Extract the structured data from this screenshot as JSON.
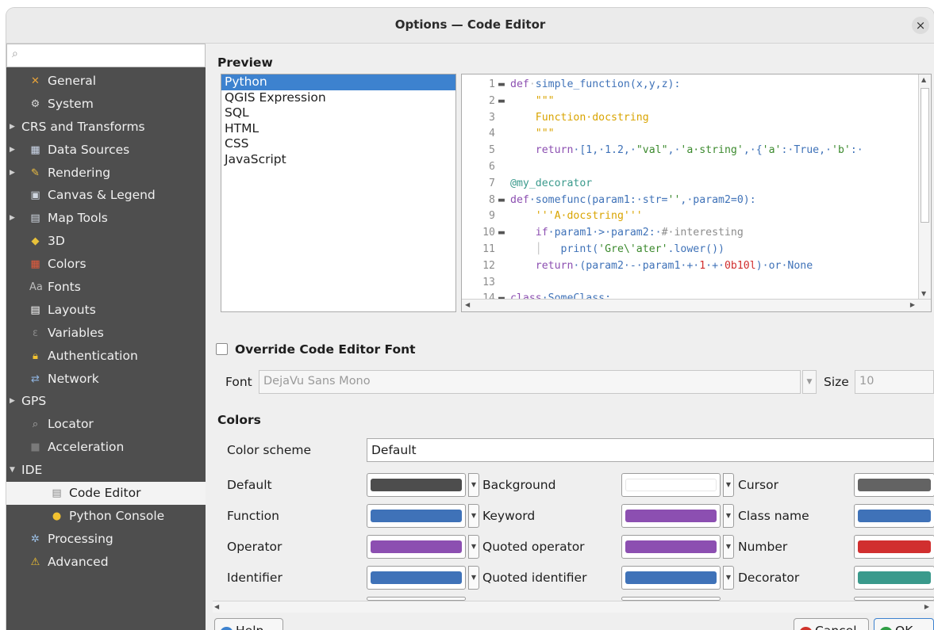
{
  "window": {
    "title": "Options — Code Editor",
    "close": "×"
  },
  "sidebar": {
    "search_placeholder": "",
    "items": [
      {
        "label": "General",
        "icon": "wrench-icon",
        "glyph": "✕",
        "color": "#e8a33a",
        "kind": "top"
      },
      {
        "label": "System",
        "icon": "system-icon",
        "glyph": "⚙",
        "color": "#d8d8d8",
        "kind": "top"
      },
      {
        "label": "CRS and Transforms",
        "icon": "",
        "glyph": "",
        "color": "",
        "kind": "cat"
      },
      {
        "label": "Data Sources",
        "icon": "table-icon",
        "glyph": "▦",
        "color": "#cdd8ea",
        "kind": "top",
        "arrow": true
      },
      {
        "label": "Rendering",
        "icon": "brush-icon",
        "glyph": "✎",
        "color": "#f0c040",
        "kind": "top",
        "arrow": true
      },
      {
        "label": "Canvas & Legend",
        "icon": "canvas-icon",
        "glyph": "▣",
        "color": "#cfd6e0",
        "kind": "top"
      },
      {
        "label": "Map Tools",
        "icon": "map-tools-icon",
        "glyph": "▤",
        "color": "#cfd6e0",
        "kind": "top",
        "arrow": true
      },
      {
        "label": "3D",
        "icon": "cube-icon",
        "glyph": "◆",
        "color": "#e8c23a",
        "kind": "top"
      },
      {
        "label": "Colors",
        "icon": "palette-icon",
        "glyph": "▦",
        "color": "#e45b3c",
        "kind": "top"
      },
      {
        "label": "Fonts",
        "icon": "fonts-icon",
        "glyph": "Aa",
        "color": "#bdbdbd",
        "kind": "top"
      },
      {
        "label": "Layouts",
        "icon": "layout-icon",
        "glyph": "▤",
        "color": "#ffffff",
        "kind": "top"
      },
      {
        "label": "Variables",
        "icon": "variables-icon",
        "glyph": "ε",
        "color": "#8a8a8a",
        "kind": "top"
      },
      {
        "label": "Authentication",
        "icon": "lock-icon",
        "glyph": "🔒︎",
        "color": "#f2c230",
        "kind": "top"
      },
      {
        "label": "Network",
        "icon": "network-icon",
        "glyph": "⇄",
        "color": "#8fb4e0",
        "kind": "top"
      },
      {
        "label": "GPS",
        "icon": "",
        "glyph": "",
        "color": "",
        "kind": "cat"
      },
      {
        "label": "Locator",
        "icon": "locator-search-icon",
        "glyph": "⌕",
        "color": "#b0b0b0",
        "kind": "top"
      },
      {
        "label": "Acceleration",
        "icon": "chip-icon",
        "glyph": "■",
        "color": "#7a7a7a",
        "kind": "top"
      },
      {
        "label": "IDE",
        "icon": "",
        "glyph": "",
        "color": "",
        "kind": "cat",
        "expanded": true
      },
      {
        "label": "Code Editor",
        "icon": "code-file-icon",
        "glyph": "▤",
        "color": "#8a8a8a",
        "kind": "sub",
        "selected": true
      },
      {
        "label": "Python Console",
        "icon": "python-icon",
        "glyph": "●",
        "color": "#f2c230",
        "kind": "sub"
      },
      {
        "label": "Processing",
        "icon": "gear-icon",
        "glyph": "✲",
        "color": "#9ec3ea",
        "kind": "top"
      },
      {
        "label": "Advanced",
        "icon": "warning-icon",
        "glyph": "⚠",
        "color": "#f2c230",
        "kind": "top"
      }
    ]
  },
  "preview": {
    "heading": "Preview",
    "languages": [
      "Python",
      "QGIS Expression",
      "SQL",
      "HTML",
      "CSS",
      "JavaScript"
    ],
    "selected_language": "Python",
    "code_lines": [
      {
        "n": "1",
        "fold": "▬",
        "segs": [
          [
            "def",
            "#8c4fb1"
          ],
          [
            "·",
            "#c0c0c0"
          ],
          [
            "simple_function(x,y,z):",
            "#3f72b8"
          ]
        ]
      },
      {
        "n": "2",
        "fold": "▬",
        "segs": [
          [
            "    ",
            "#c0c0c0"
          ],
          [
            "\"\"\"",
            "#d9a400"
          ]
        ]
      },
      {
        "n": "3",
        "fold": "",
        "segs": [
          [
            "    ",
            "#c0c0c0"
          ],
          [
            "Function·docstring",
            "#d9a400"
          ]
        ]
      },
      {
        "n": "4",
        "fold": "",
        "segs": [
          [
            "    ",
            "#c0c0c0"
          ],
          [
            "\"\"\"",
            "#d9a400"
          ]
        ]
      },
      {
        "n": "5",
        "fold": "",
        "segs": [
          [
            "    ",
            "#c0c0c0"
          ],
          [
            "return",
            "#8c4fb1"
          ],
          [
            "·[1,·1.2,·",
            "#3f72b8"
          ],
          [
            "\"val\"",
            "#3c8a2e"
          ],
          [
            ",·",
            "#3f72b8"
          ],
          [
            "'a·string'",
            "#3c8a2e"
          ],
          [
            ",·{",
            "#3f72b8"
          ],
          [
            "'a'",
            "#3c8a2e"
          ],
          [
            ":·True,·",
            "#3f72b8"
          ],
          [
            "'b'",
            "#3c8a2e"
          ],
          [
            ":·",
            "#3f72b8"
          ]
        ]
      },
      {
        "n": "6",
        "fold": "",
        "segs": []
      },
      {
        "n": "7",
        "fold": "",
        "segs": [
          [
            "@my_decorator",
            "#3a9a8c"
          ]
        ]
      },
      {
        "n": "8",
        "fold": "▬",
        "segs": [
          [
            "def",
            "#8c4fb1"
          ],
          [
            "·somefunc(param1:·str=",
            "#3f72b8"
          ],
          [
            "''",
            "#3c8a2e"
          ],
          [
            ",·param2=0):",
            "#3f72b8"
          ]
        ]
      },
      {
        "n": "9",
        "fold": "",
        "segs": [
          [
            "    ",
            "#c0c0c0"
          ],
          [
            "'''A·docstring'''",
            "#d9a400"
          ]
        ]
      },
      {
        "n": "10",
        "fold": "▬",
        "segs": [
          [
            "    ",
            "#c0c0c0"
          ],
          [
            "if",
            "#8c4fb1"
          ],
          [
            "·param1·>·param2:·",
            "#3f72b8"
          ],
          [
            "#·interesting",
            "#8c8c8c"
          ]
        ]
      },
      {
        "n": "11",
        "fold": "",
        "segs": [
          [
            "    │   ",
            "#c0c0c0"
          ],
          [
            "print(",
            "#3f72b8"
          ],
          [
            "'Gre\\'ater'",
            "#3c8a2e"
          ],
          [
            ".lower())",
            "#3f72b8"
          ]
        ]
      },
      {
        "n": "12",
        "fold": "",
        "segs": [
          [
            "    ",
            "#c0c0c0"
          ],
          [
            "return",
            "#8c4fb1"
          ],
          [
            "·(param2·-·param1·+·",
            "#3f72b8"
          ],
          [
            "1",
            "#d12f2f"
          ],
          [
            "·+·",
            "#3f72b8"
          ],
          [
            "0b10l",
            "#d12f2f"
          ],
          [
            ")·or·None",
            "#3f72b8"
          ]
        ]
      },
      {
        "n": "13",
        "fold": "",
        "segs": []
      },
      {
        "n": "14",
        "fold": "▬",
        "segs": [
          [
            "class",
            "#8c4fb1"
          ],
          [
            "·SomeClass:",
            "#3f72b8"
          ]
        ]
      }
    ]
  },
  "font": {
    "override_label": "Override Code Editor Font",
    "font_label": "Font",
    "font_value": "DejaVu Sans Mono",
    "size_label": "Size",
    "size_value": "10"
  },
  "colors": {
    "heading": "Colors",
    "scheme_label": "Color scheme",
    "scheme_value": "Default",
    "rows": [
      [
        {
          "label": "Default",
          "color": "#4d4d4d"
        },
        {
          "label": "Background",
          "color": "#ffffff"
        },
        {
          "label": "Cursor",
          "color": "#636363"
        }
      ],
      [
        {
          "label": "Function",
          "color": "#3f72b8"
        },
        {
          "label": "Keyword",
          "color": "#8c4fb1"
        },
        {
          "label": "Class name",
          "color": "#3f72b8"
        }
      ],
      [
        {
          "label": "Operator",
          "color": "#8c4fb1"
        },
        {
          "label": "Quoted operator",
          "color": "#8c4fb1"
        },
        {
          "label": "Number",
          "color": "#d12f2f"
        }
      ],
      [
        {
          "label": "Identifier",
          "color": "#3f72b8"
        },
        {
          "label": "Quoted identifier",
          "color": "#3f72b8"
        },
        {
          "label": "Decorator",
          "color": "#3a9a8c"
        }
      ]
    ],
    "partial_row": [
      {
        "color": "#3f72b8"
      },
      {
        "color": "#3f72b8"
      },
      {
        "color": "#d12f2f"
      }
    ]
  },
  "buttons": {
    "help": "Help",
    "cancel": "Cancel",
    "ok": "OK"
  }
}
